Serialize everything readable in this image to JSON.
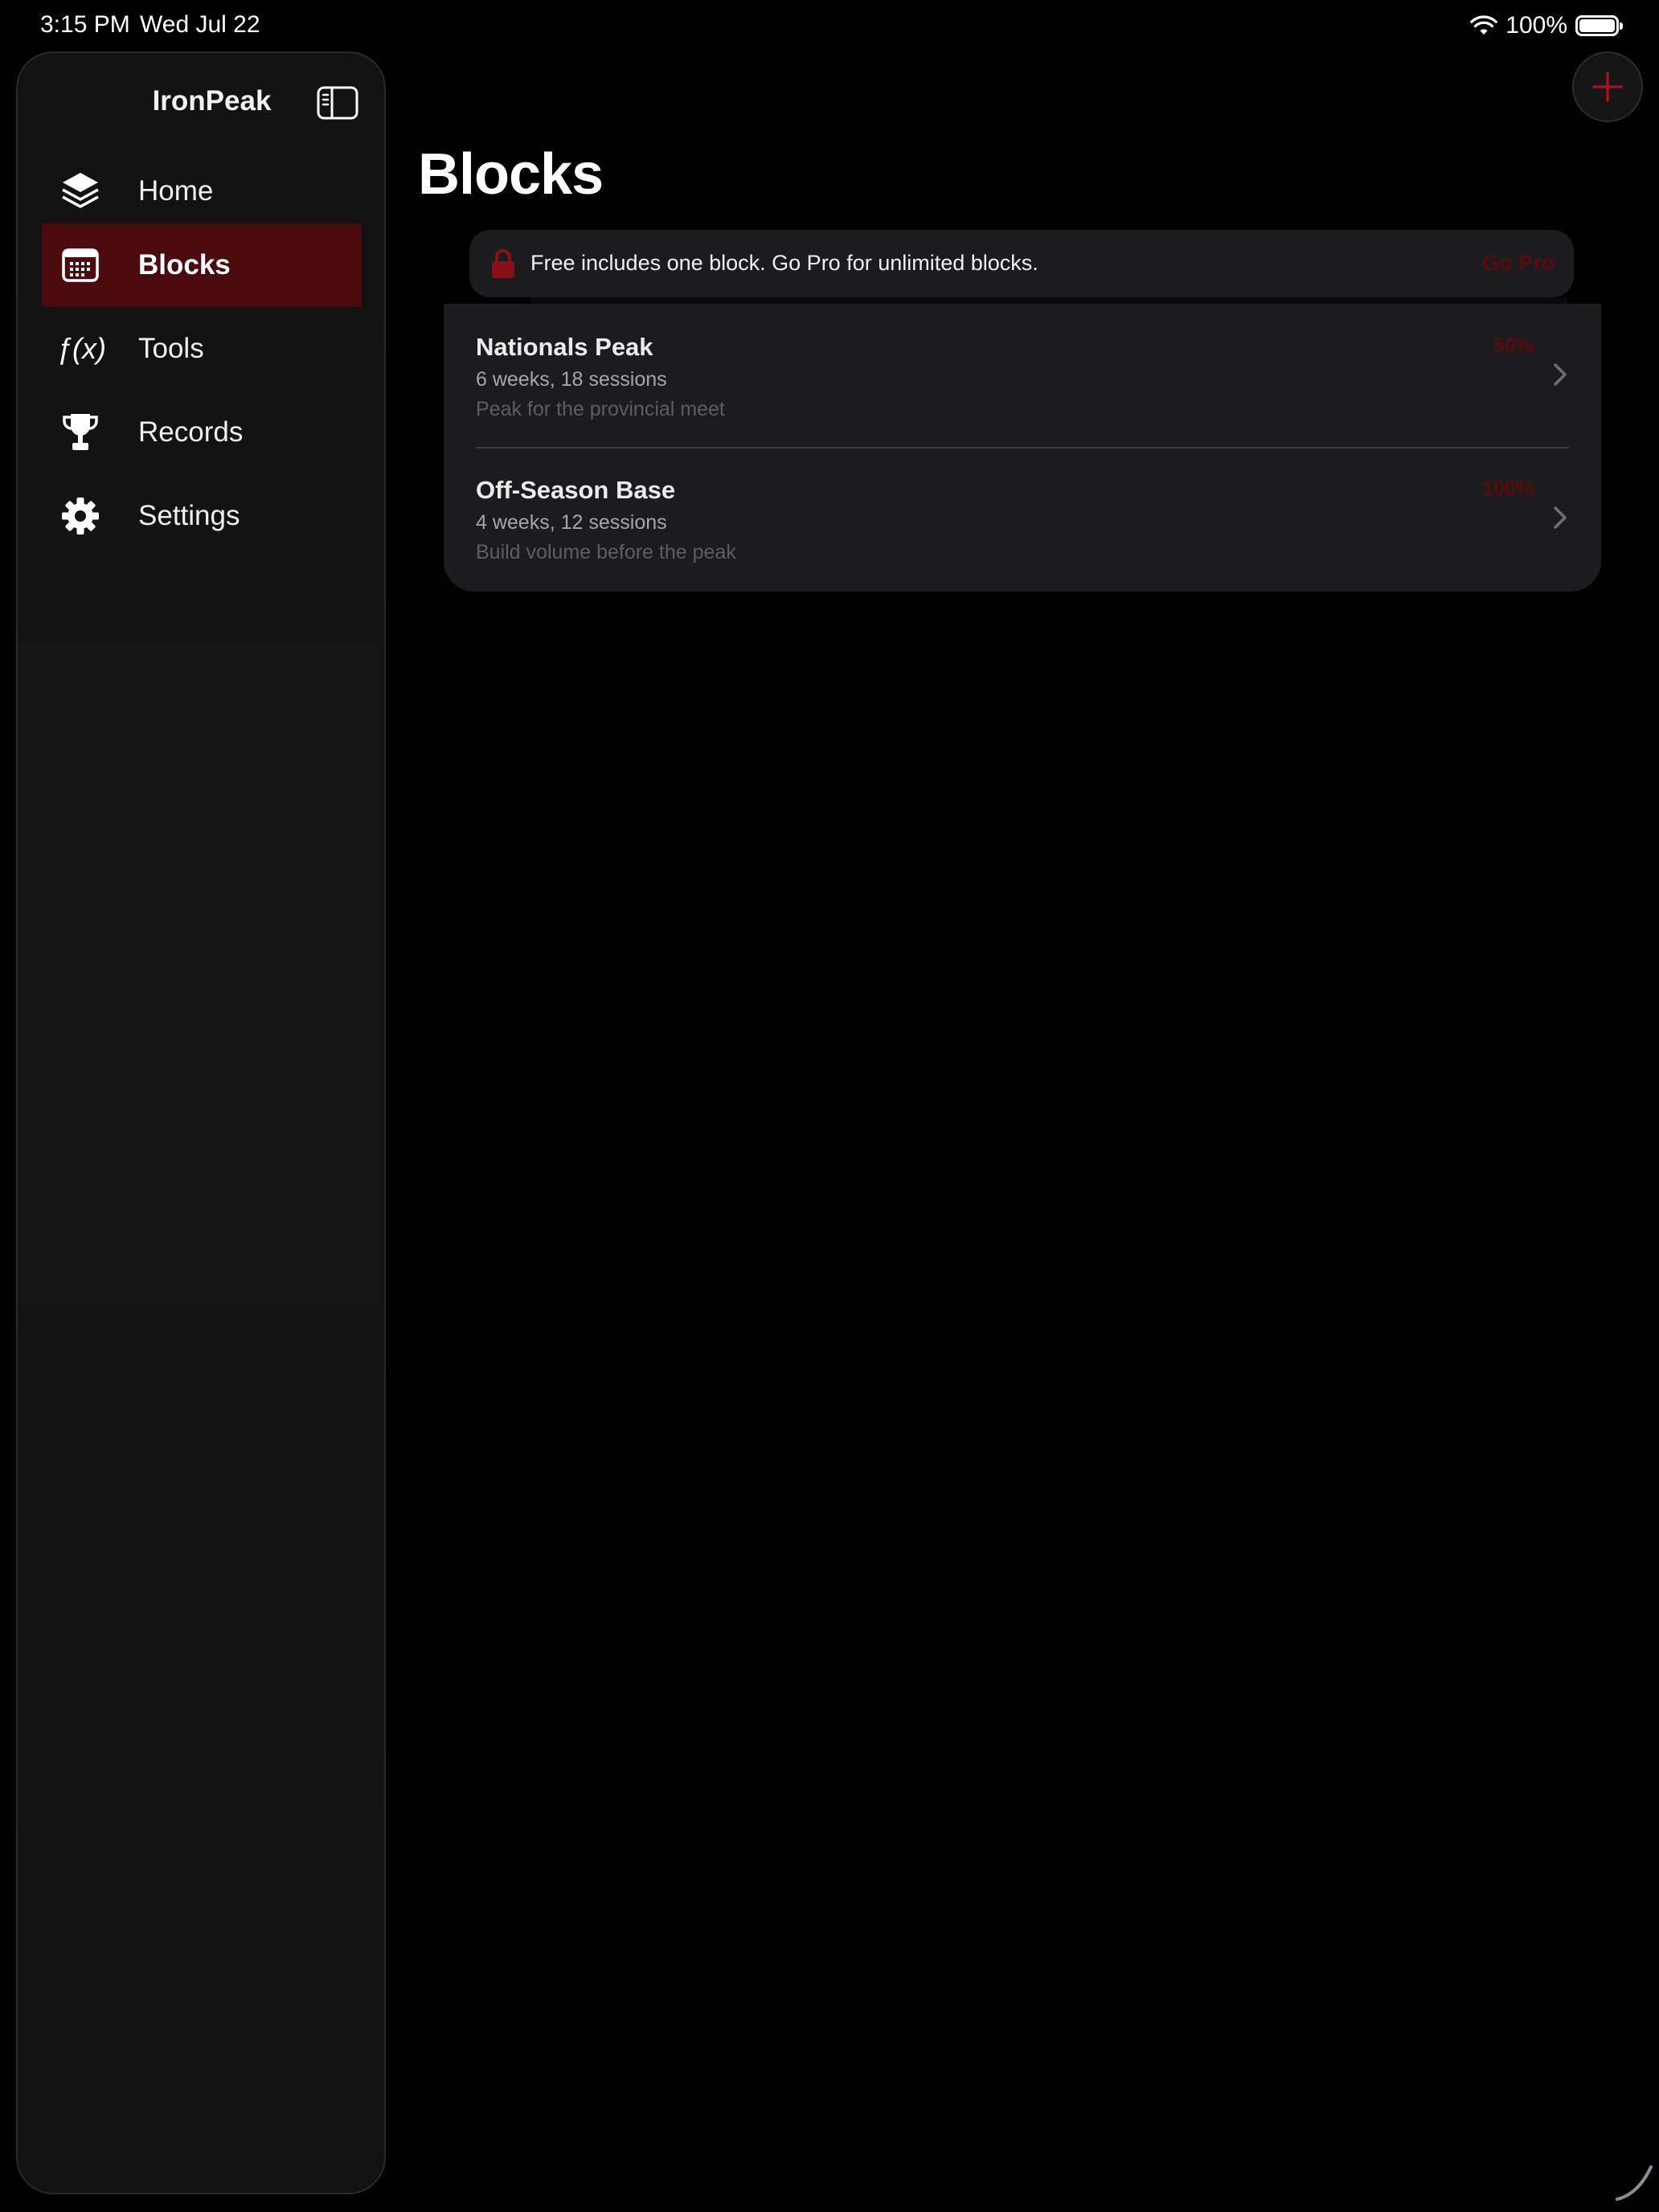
{
  "status_bar": {
    "time": "3:15 PM",
    "date": "Wed Jul 22",
    "battery": "100%",
    "icons": [
      "wifi-icon",
      "battery-icon"
    ]
  },
  "sidebar": {
    "app_title": "IronPeak",
    "toggle_icon": "sidebar-toggle-icon",
    "items": [
      {
        "label": "Home",
        "icon": "layers-icon",
        "active": false
      },
      {
        "label": "Blocks",
        "icon": "calendar-icon",
        "active": true
      },
      {
        "label": "Tools",
        "icon": "function-icon",
        "active": false
      },
      {
        "label": "Records",
        "icon": "trophy-icon",
        "active": false
      },
      {
        "label": "Settings",
        "icon": "gear-icon",
        "active": false
      }
    ],
    "tools_icon_glyph": "ƒ(x)"
  },
  "main": {
    "title": "Blocks",
    "add_icon": "plus-icon",
    "banner": {
      "icon": "lock-icon",
      "text": "Free includes one block. Go Pro for unlimited blocks.",
      "action": "Go Pro"
    },
    "blocks": [
      {
        "name": "Nationals Peak",
        "summary": "6 weeks, 18 sessions",
        "description": "Peak for the provincial meet",
        "progress": "50%"
      },
      {
        "name": "Off-Season Base",
        "summary": "4 weeks, 12 sessions",
        "description": "Build volume before the peak",
        "progress": "100%"
      }
    ]
  },
  "colors": {
    "accent": "#a4121c",
    "active_nav_bg": "#4b0b0e",
    "card_bg": "#1c1c1e",
    "background": "#000000"
  }
}
